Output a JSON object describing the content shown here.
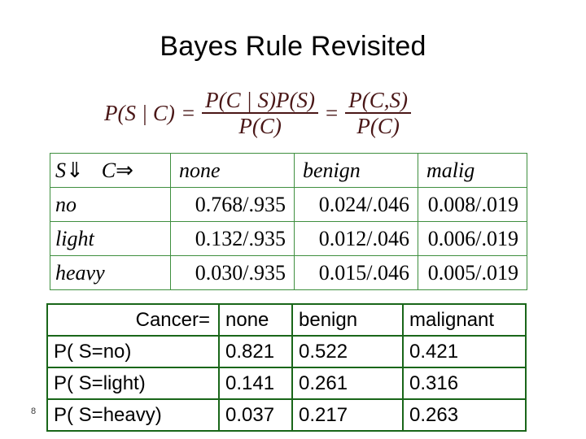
{
  "slide": {
    "title": "Bayes Rule Revisited",
    "page_number": "8"
  },
  "formula": {
    "lhs": "P(S | C)",
    "eq1": "=",
    "frac1_numerator": "P(C | S)P(S)",
    "frac1_denominator": "P(C)",
    "eq2": "=",
    "frac2_numerator": "P(C,S)",
    "frac2_denominator": "P(C)",
    "color": "#4a1717"
  },
  "joint_table": {
    "border_color": "#3f8f3f",
    "corner_row_var": "S",
    "corner_row_arrow": "⇓",
    "corner_col_var": "C",
    "corner_col_arrow": "⇒",
    "columns": [
      "none",
      "benign",
      "malig"
    ],
    "rows": [
      {
        "label": "no",
        "values": [
          "0.768/.935",
          "0.024/.046",
          "0.008/.019"
        ]
      },
      {
        "label": "light",
        "values": [
          "0.132/.935",
          "0.012/.046",
          "0.006/.019"
        ]
      },
      {
        "label": "heavy",
        "values": [
          "0.030/.935",
          "0.015/.046",
          "0.005/.019"
        ]
      }
    ]
  },
  "posterior_table": {
    "border_color": "#196619",
    "corner_label": "Cancer=",
    "columns": [
      "none",
      "benign",
      "malignant"
    ],
    "rows": [
      {
        "label": "P( S=no)",
        "values": [
          "0.821",
          "0.522",
          "0.421"
        ]
      },
      {
        "label": "P( S=light)",
        "values": [
          "0.141",
          "0.261",
          "0.316"
        ]
      },
      {
        "label": "P( S=heavy)",
        "values": [
          "0.037",
          "0.217",
          "0.263"
        ]
      }
    ]
  }
}
